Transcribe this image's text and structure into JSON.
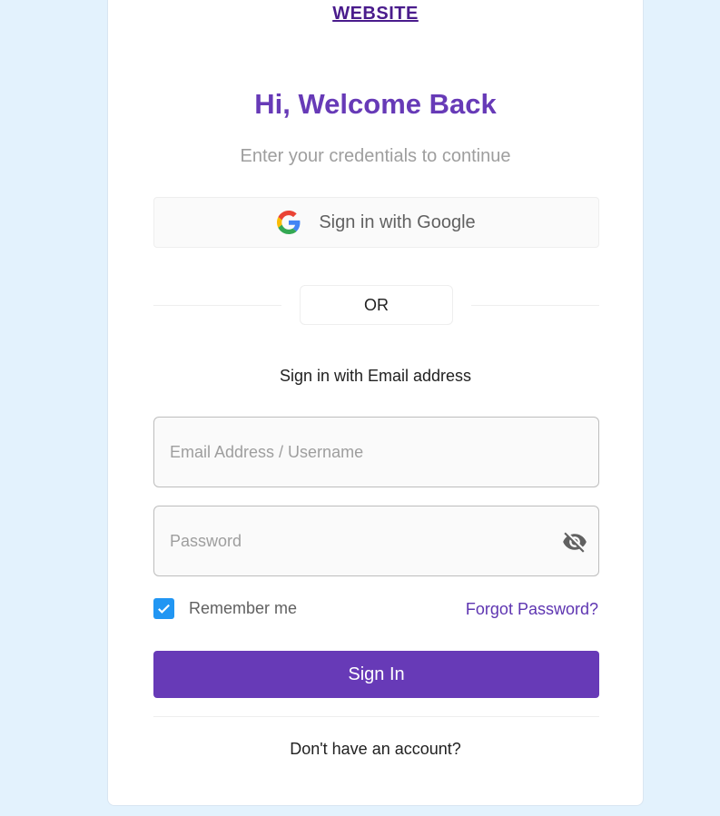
{
  "brand": {
    "logo_text": "WEBSITE"
  },
  "header": {
    "title": "Hi, Welcome Back",
    "subtitle": "Enter your credentials to continue"
  },
  "google": {
    "label": "Sign in with Google",
    "icon": "google-icon"
  },
  "divider": {
    "label": "OR"
  },
  "email_section": {
    "caption": "Sign in with Email address"
  },
  "form": {
    "email": {
      "value": "",
      "placeholder": "Email Address / Username"
    },
    "password": {
      "value": "",
      "placeholder": "Password",
      "toggle_icon": "eye-off-icon"
    },
    "remember": {
      "label": "Remember me",
      "checked": true
    },
    "forgot_label": "Forgot Password?",
    "submit_label": "Sign In"
  },
  "footer": {
    "signup_text": "Don't have an account?"
  },
  "colors": {
    "background": "#e3f2fd",
    "primary": "#673ab7",
    "link": "#5e35b1",
    "checkbox": "#2196f3"
  }
}
